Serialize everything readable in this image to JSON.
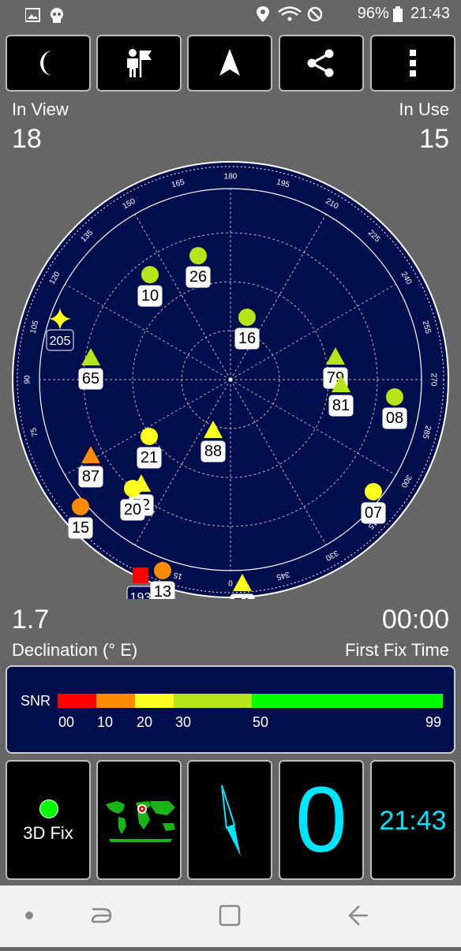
{
  "status_bar": {
    "battery": "96%",
    "time": "21:43",
    "icons": [
      "image-icon",
      "skull-icon",
      "location-icon",
      "wifi-icon",
      "block-icon",
      "battery-icon"
    ]
  },
  "toolbar": {
    "buttons": [
      "night-mode-icon",
      "man-flag-icon",
      "navigation-arrow-icon",
      "share-icon",
      "more-vert-icon"
    ]
  },
  "counts": {
    "in_view_label": "In View",
    "in_view": "18",
    "in_use_label": "In Use",
    "in_use": "15"
  },
  "sky_plot": {
    "azimuth_labels": [
      "0",
      "15",
      "45",
      "75",
      "90",
      "105",
      "120",
      "135",
      "150",
      "165",
      "180",
      "195",
      "210",
      "225",
      "240",
      "255",
      "270",
      "285",
      "300",
      "315",
      "330",
      "345"
    ],
    "satellites": [
      {
        "id": "10",
        "shape": "circle",
        "color": "#b6e61a"
      },
      {
        "id": "26",
        "shape": "circle",
        "color": "#b6e61a"
      },
      {
        "id": "16",
        "shape": "circle",
        "color": "#b6e61a"
      },
      {
        "id": "205",
        "shape": "star",
        "color": "#ffff1f"
      },
      {
        "id": "65",
        "shape": "triangle",
        "color": "#b6e61a"
      },
      {
        "id": "79",
        "shape": "triangle",
        "color": "#b6e61a"
      },
      {
        "id": "81",
        "shape": "triangle",
        "color": "#b6e61a"
      },
      {
        "id": "08",
        "shape": "circle",
        "color": "#b6e61a"
      },
      {
        "id": "21",
        "shape": "circle",
        "color": "#ffff1f"
      },
      {
        "id": "88",
        "shape": "triangle",
        "color": "#ffff1f"
      },
      {
        "id": "87",
        "shape": "triangle",
        "color": "#ff8c00"
      },
      {
        "id": "72",
        "shape": "triangle",
        "color": "#ffff1f"
      },
      {
        "id": "20",
        "shape": "circle",
        "color": "#ffff1f"
      },
      {
        "id": "15",
        "shape": "circle",
        "color": "#ff8c00"
      },
      {
        "id": "07",
        "shape": "circle",
        "color": "#ffff1f"
      },
      {
        "id": "193",
        "shape": "square",
        "color": "#ff0000"
      },
      {
        "id": "13",
        "shape": "circle",
        "color": "#ff8c00"
      },
      {
        "id": "71",
        "shape": "triangle",
        "color": "#ffff1f"
      }
    ]
  },
  "declination": {
    "value": "1.7",
    "label": "Declination (° E)"
  },
  "first_fix": {
    "value": "00:00",
    "label": "First Fix Time"
  },
  "snr": {
    "label": "SNR",
    "ticks": [
      "00",
      "10",
      "20",
      "30",
      "50",
      "99"
    ],
    "colors": [
      "#ff0000",
      "#ff8c00",
      "#ffff1f",
      "#b6e61a",
      "#00ff00"
    ]
  },
  "tiles": {
    "fix": {
      "label": "3D Fix",
      "dot_color": "#00ff00"
    },
    "map": {
      "icon": "world-map-icon"
    },
    "compass": {
      "icon": "compass-needle-icon"
    },
    "speed": {
      "value": "0"
    },
    "clock": {
      "value": "21:43"
    }
  },
  "nav_bar": {
    "buttons": [
      "home-dot-icon",
      "recents-icon",
      "overview-icon",
      "back-icon"
    ]
  }
}
